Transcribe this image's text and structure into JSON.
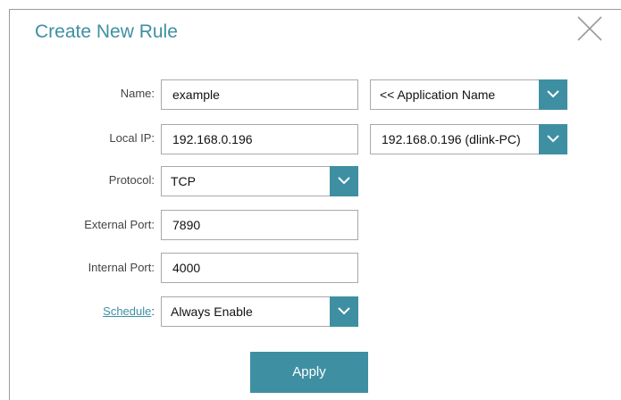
{
  "dialog": {
    "title": "Create New Rule",
    "close_icon": "close-icon"
  },
  "form": {
    "name": {
      "label": "Name:",
      "value": "example"
    },
    "application": {
      "value": "<< Application Name",
      "icon": "chevron-down-icon"
    },
    "local_ip": {
      "label": "Local IP:",
      "value": "192.168.0.196"
    },
    "local_ip_select": {
      "value": "192.168.0.196 (dlink-PC)",
      "icon": "chevron-down-icon"
    },
    "protocol": {
      "label": "Protocol:",
      "value": "TCP",
      "icon": "chevron-down-icon"
    },
    "external_port": {
      "label": "External Port:",
      "value": "7890"
    },
    "internal_port": {
      "label": "Internal Port:",
      "value": "4000"
    },
    "schedule": {
      "label": "Schedule",
      "colon": ":",
      "value": "Always Enable",
      "icon": "chevron-down-icon"
    }
  },
  "apply_label": "Apply",
  "colors": {
    "accent": "#3f8fa3",
    "border": "#a9a9a9",
    "label": "#444444"
  }
}
